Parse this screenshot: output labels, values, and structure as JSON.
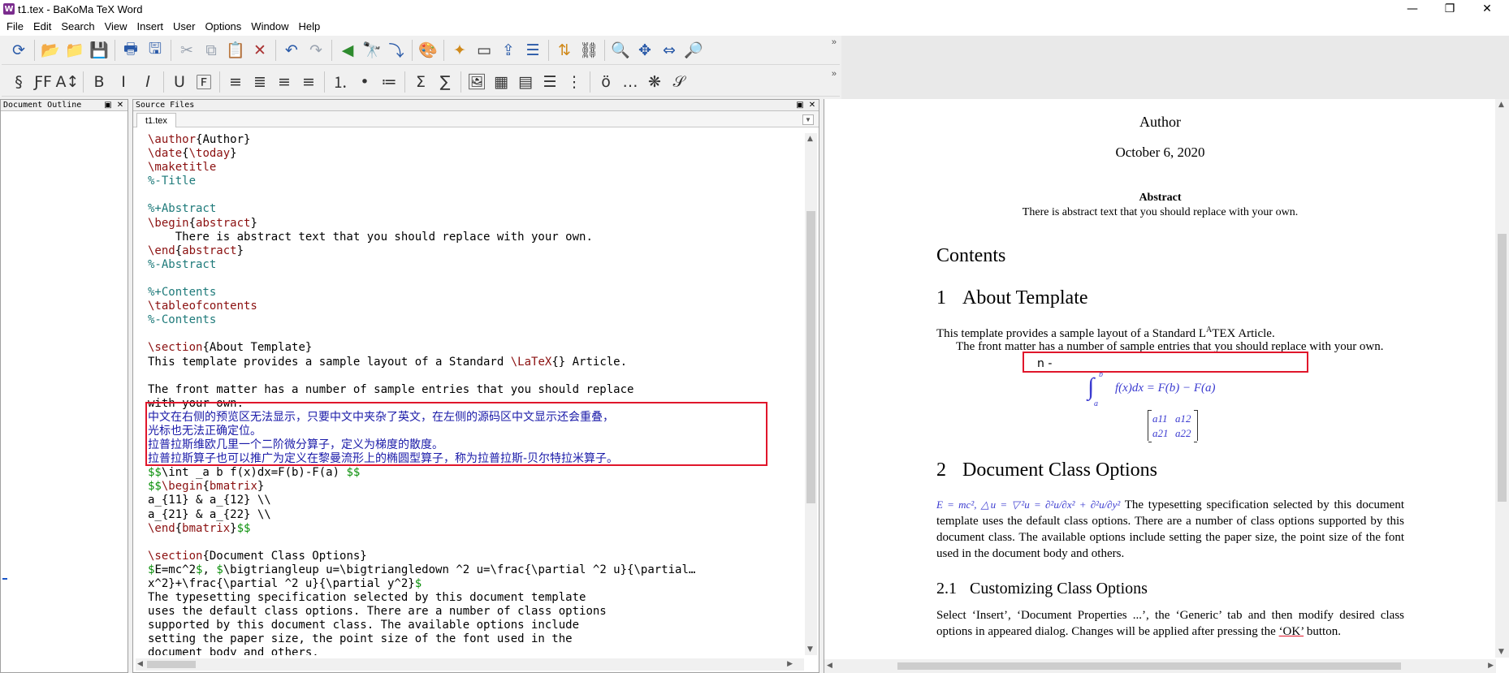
{
  "window": {
    "title": "t1.tex - BaKoMa TeX Word",
    "app_icon_letter": "W",
    "controls": {
      "minimize": "—",
      "maximize": "❐",
      "close": "✕"
    }
  },
  "menu": [
    "File",
    "Edit",
    "Search",
    "View",
    "Insert",
    "User",
    "Options",
    "Window",
    "Help"
  ],
  "toolbar_top": [
    {
      "name": "refresh-icon",
      "glyph": "⟳"
    },
    {
      "name": "open-folder-icon",
      "glyph": "📂"
    },
    {
      "name": "open-icon",
      "glyph": "📁"
    },
    {
      "name": "save-disk-icon",
      "glyph": "💾"
    },
    {
      "name": "print-icon",
      "glyph": "🖶"
    },
    {
      "name": "save-icon",
      "glyph": "🖫"
    },
    {
      "name": "cut-icon",
      "glyph": "✂"
    },
    {
      "name": "copy-icon",
      "glyph": "⧉"
    },
    {
      "name": "paste-icon",
      "glyph": "📋"
    },
    {
      "name": "delete-icon",
      "glyph": "✕"
    },
    {
      "name": "undo-icon",
      "glyph": "↶"
    },
    {
      "name": "redo-icon",
      "glyph": "↷"
    },
    {
      "name": "go-back-icon",
      "glyph": "◀"
    },
    {
      "name": "find-icon",
      "glyph": "🔭"
    },
    {
      "name": "jump-icon",
      "glyph": "⤵"
    },
    {
      "name": "palette-icon",
      "glyph": "🎨"
    },
    {
      "name": "new-note-icon",
      "glyph": "✦"
    },
    {
      "name": "eraser-icon",
      "glyph": "▭"
    },
    {
      "name": "export-icon",
      "glyph": "⇪"
    },
    {
      "name": "layers-icon",
      "glyph": "☰"
    },
    {
      "name": "sort-icon",
      "glyph": "⇅"
    },
    {
      "name": "link-icon",
      "glyph": "⛓"
    },
    {
      "name": "zoom-out-icon",
      "glyph": "🔍"
    },
    {
      "name": "move-icon",
      "glyph": "✥"
    },
    {
      "name": "fit-width-icon",
      "glyph": "⇔"
    },
    {
      "name": "zoom-in-icon",
      "glyph": "🔎"
    }
  ],
  "toolbar_format": [
    {
      "name": "section-icon",
      "glyph": "§"
    },
    {
      "name": "font-family-icon",
      "glyph": "ƑF"
    },
    {
      "name": "font-size-icon",
      "glyph": "A↕"
    },
    {
      "name": "bold-icon",
      "glyph": "B"
    },
    {
      "name": "italic-icon",
      "glyph": "I"
    },
    {
      "name": "slanted-icon",
      "glyph": "𝐼"
    },
    {
      "name": "underline-icon",
      "glyph": "U"
    },
    {
      "name": "frame-icon",
      "glyph": "🄵"
    },
    {
      "name": "align-left-icon",
      "glyph": "≡"
    },
    {
      "name": "align-center-icon",
      "glyph": "≣"
    },
    {
      "name": "align-right-icon",
      "glyph": "≡"
    },
    {
      "name": "align-justify-icon",
      "glyph": "≡"
    },
    {
      "name": "numbered-list-icon",
      "glyph": "⒈"
    },
    {
      "name": "bullet-list-icon",
      "glyph": "•"
    },
    {
      "name": "description-list-icon",
      "glyph": "≔"
    },
    {
      "name": "sum-icon",
      "glyph": "Σ"
    },
    {
      "name": "display-sum-icon",
      "glyph": "∑"
    },
    {
      "name": "image-icon",
      "glyph": "🖼"
    },
    {
      "name": "table-icon",
      "glyph": "▦"
    },
    {
      "name": "box-icon",
      "glyph": "▤"
    },
    {
      "name": "lines-icon",
      "glyph": "☰"
    },
    {
      "name": "columns-icon",
      "glyph": "⋮"
    },
    {
      "name": "accent-icon",
      "glyph": "ö"
    },
    {
      "name": "dots-icon",
      "glyph": "…"
    },
    {
      "name": "asterisk-icon",
      "glyph": "❋"
    },
    {
      "name": "script-icon",
      "glyph": "𝒮"
    }
  ],
  "panels": {
    "outline_title": "Document Outline",
    "source_title": "Source Files",
    "tab_label": "t1.tex"
  },
  "source_lines": [
    [
      [
        "cmd",
        "\\author"
      ],
      [
        "txt",
        "{Author}"
      ]
    ],
    [
      [
        "cmd",
        "\\date"
      ],
      [
        "txt",
        "{"
      ],
      [
        "cmd",
        "\\today"
      ],
      [
        "txt",
        "}"
      ]
    ],
    [
      [
        "cmd",
        "\\maketitle"
      ]
    ],
    [
      [
        "com",
        "%-Title"
      ]
    ],
    [],
    [
      [
        "com",
        "%+Abstract"
      ]
    ],
    [
      [
        "cmd",
        "\\begin"
      ],
      [
        "txt",
        "{"
      ],
      [
        "cmd",
        "abstract"
      ],
      [
        "txt",
        "}"
      ]
    ],
    [
      [
        "txt",
        "    There is abstract text that you should replace with your own."
      ]
    ],
    [
      [
        "cmd",
        "\\end"
      ],
      [
        "txt",
        "{"
      ],
      [
        "cmd",
        "abstract"
      ],
      [
        "txt",
        "}"
      ]
    ],
    [
      [
        "com",
        "%-Abstract"
      ]
    ],
    [],
    [
      [
        "com",
        "%+Contents"
      ]
    ],
    [
      [
        "cmd",
        "\\tableofcontents"
      ]
    ],
    [
      [
        "com",
        "%-Contents"
      ]
    ],
    [],
    [
      [
        "cmd",
        "\\section"
      ],
      [
        "txt",
        "{About Template}"
      ]
    ],
    [
      [
        "txt",
        "This template provides a sample layout of a Standard "
      ],
      [
        "cmd",
        "\\LaTeX"
      ],
      [
        "txt",
        "{} Article."
      ]
    ],
    [],
    [
      [
        "txt",
        "The front matter has a number of sample entries that you should replace"
      ]
    ],
    [
      [
        "txt",
        "with your own."
      ]
    ],
    [
      [
        "cjk",
        "中文在右侧的预览区无法显示，只要中文中夹杂了英文，在左侧的源码区中文显示还会重叠，"
      ]
    ],
    [
      [
        "cjk",
        "光标也无法正确定位。"
      ]
    ],
    [
      [
        "cjk",
        "拉普拉斯维欧几里一个二阶微分算子，定义为梯度的散度。"
      ]
    ],
    [
      [
        "cjk",
        "拉普拉斯算子也可以推广为定义在黎曼流形上的椭圆型算子，称为拉普拉斯-贝尔特拉米算子。"
      ]
    ],
    [
      [
        "math",
        "$$"
      ],
      [
        "txt",
        "\\int _a b f(x)dx=F(b)-F(a) "
      ],
      [
        "math",
        "$$"
      ]
    ],
    [
      [
        "math",
        "$$"
      ],
      [
        "cmd",
        "\\begin"
      ],
      [
        "txt",
        "{"
      ],
      [
        "cmd",
        "bmatrix"
      ],
      [
        "txt",
        "}"
      ]
    ],
    [
      [
        "txt",
        "a_{11} & a_{12} \\\\"
      ]
    ],
    [
      [
        "txt",
        "a_{21} & a_{22} \\\\"
      ]
    ],
    [
      [
        "cmd",
        "\\end"
      ],
      [
        "txt",
        "{"
      ],
      [
        "cmd",
        "bmatrix"
      ],
      [
        "txt",
        "}"
      ],
      [
        "math",
        "$$"
      ]
    ],
    [],
    [
      [
        "cmd",
        "\\section"
      ],
      [
        "txt",
        "{Document Class Options}"
      ]
    ],
    [
      [
        "math",
        "$"
      ],
      [
        "txt",
        "E=mc^2"
      ],
      [
        "math",
        "$"
      ],
      [
        "txt",
        ", "
      ],
      [
        "math",
        "$"
      ],
      [
        "txt",
        "\\bigtriangleup u=\\bigtriangledown ^2 u=\\frac{\\partial ^2 u}{\\partial…"
      ]
    ],
    [
      [
        "txt",
        "x^2}+\\frac{\\partial ^2 u}{\\partial y^2}"
      ],
      [
        "math",
        "$"
      ]
    ],
    [
      [
        "txt",
        "The typesetting specification selected by this document template"
      ]
    ],
    [
      [
        "txt",
        "uses the default class options. There are a number of class options"
      ]
    ],
    [
      [
        "txt",
        "supported by this document class. The available options include"
      ]
    ],
    [
      [
        "txt",
        "setting the paper size, the point size of the font used in the"
      ]
    ],
    [
      [
        "txt",
        "document body and others."
      ]
    ]
  ],
  "preview": {
    "author": "Author",
    "date": "October 6, 2020",
    "abstract_title": "Abstract",
    "abstract_text": "There is abstract text that you should replace with your own.",
    "contents_heading": "Contents",
    "sec1_num": "1",
    "sec1_title": "About Template",
    "sec1_p1_a": "This template provides a sample layout of a Standard L",
    "sec1_p1_sup": "A",
    "sec1_p1_b": "TEX Article.",
    "sec1_p2": "The front matter has a number of sample entries that you should replace with your own.",
    "garbled": "n -",
    "integral": "∫",
    "integral_upper": "b",
    "integral_lower": "a",
    "integral_expr": "f(x)dx = F(b) − F(a)",
    "matrix": [
      "a11",
      "a12",
      "a21",
      "a22"
    ],
    "sec2_num": "2",
    "sec2_title": "Document Class Options",
    "sec2_math": "E = mc², △u = ▽²u = ∂²u/∂x² + ∂²u/∂y²",
    "sec2_text": "The typesetting specification selected by this document template uses the default class options. There are a number of class options supported by this document class. The available options include setting the paper size, the point size of the font used in the document body and others.",
    "sub21_num": "2.1",
    "sub21_title": "Customizing Class Options",
    "sub21_text_a": "Select ‘Insert’, ‘Document Properties ...’, the ‘Generic’ tab and then modify desired class options in appeared dialog. Changes will be applied after pressing the ",
    "sub21_ok": "‘OK’",
    "sub21_text_b": " button."
  }
}
